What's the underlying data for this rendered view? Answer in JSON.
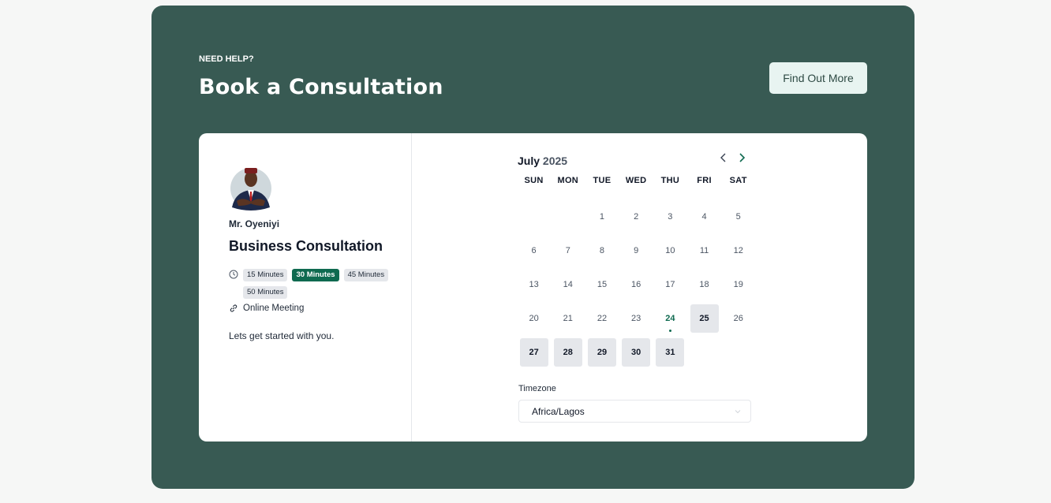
{
  "header": {
    "eyebrow": "NEED HELP?",
    "title": "Book a Consultation",
    "cta_label": "Find Out More"
  },
  "event": {
    "host": "Mr. Oyeniyi",
    "title": "Business Consultation",
    "durations": [
      "15 Minutes",
      "30 Minutes",
      "45 Minutes",
      "50 Minutes"
    ],
    "selected_duration": "30 Minutes",
    "location": "Online Meeting",
    "description": "Lets get started with you."
  },
  "calendar": {
    "month": "July",
    "year": "2025",
    "weekdays": [
      "SUN",
      "MON",
      "TUE",
      "WED",
      "THU",
      "FRI",
      "SAT"
    ],
    "first_weekday_index": 2,
    "days_in_month": 31,
    "today": 24,
    "available_days": [
      25,
      27,
      28,
      29,
      30,
      31
    ]
  },
  "timezone": {
    "label": "Timezone",
    "value": "Africa/Lagos"
  },
  "colors": {
    "panel": "#385a53",
    "accent": "#0f6a50",
    "cta_bg": "#e8f4f1"
  },
  "icons": {
    "clock": "clock-icon",
    "link": "link-icon",
    "prev": "chevron-left-icon",
    "next": "chevron-right-icon",
    "dropdown": "chevron-down-icon"
  }
}
